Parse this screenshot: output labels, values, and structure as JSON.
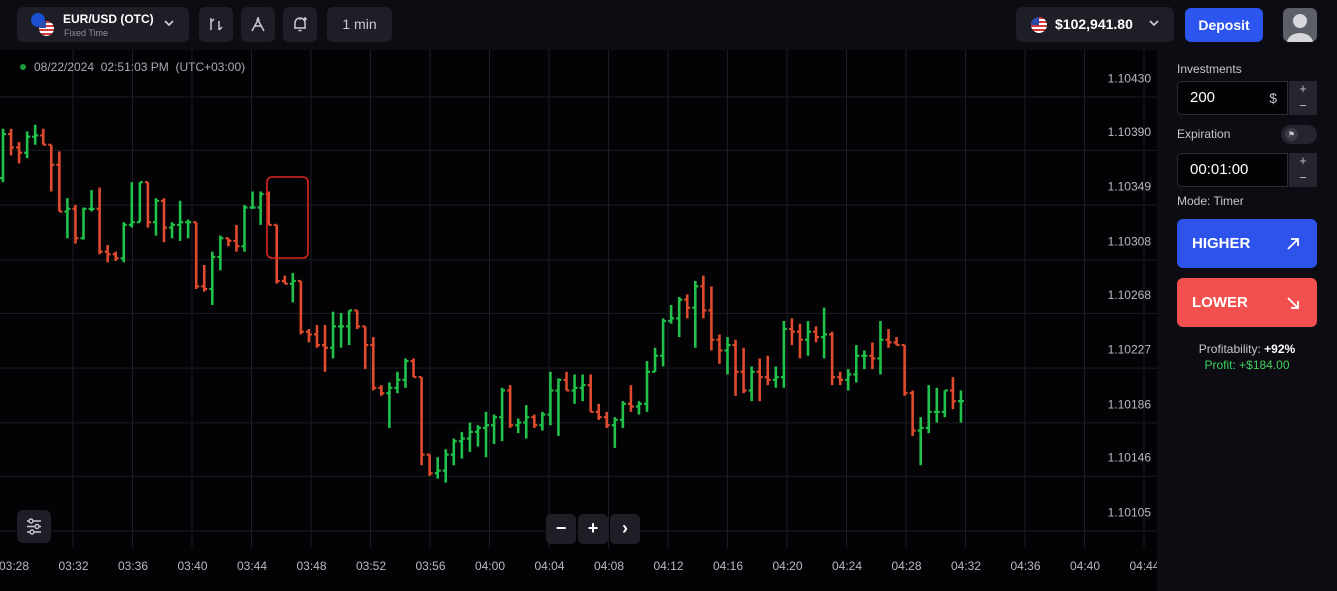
{
  "topbar": {
    "asset_name": "EUR/USD (OTC)",
    "asset_mode": "Fixed Time",
    "timeframe": "1 min",
    "balance": "$102,941.80",
    "deposit_label": "Deposit",
    "tools": [
      "drawing-tool-icon",
      "compass-indicator-icon",
      "alarm-add-icon"
    ]
  },
  "chart": {
    "timestamp": "08/22/2024",
    "time": "02:51:03 PM",
    "timezone": "(UTC+03:00)",
    "zoom_out": "−",
    "zoom_in": "+",
    "scroll_right": "›"
  },
  "chart_data": {
    "type": "ohlc",
    "y_ticks": [
      "1.10430",
      "1.10390",
      "1.10349",
      "1.10308",
      "1.10268",
      "1.10227",
      "1.10186",
      "1.10146",
      "1.10105"
    ],
    "x_ticks": [
      "03:28",
      "03:32",
      "03:36",
      "03:40",
      "03:44",
      "03:48",
      "03:52",
      "03:56",
      "04:00",
      "04:04",
      "04:08",
      "04:12",
      "04:16",
      "04:20",
      "04:24",
      "04:28",
      "04:32",
      "04:36",
      "04:40",
      "04:44"
    ],
    "up_color": "#20c24b",
    "down_color": "#e04a2d",
    "bars": [
      {
        "open": 1.10355,
        "high": 1.10392,
        "low": 1.10352,
        "close": 1.10388
      },
      {
        "open": 1.10388,
        "high": 1.10392,
        "low": 1.10372,
        "close": 1.10378
      },
      {
        "open": 1.10378,
        "high": 1.10382,
        "low": 1.10366,
        "close": 1.10374
      },
      {
        "open": 1.10374,
        "high": 1.1039,
        "low": 1.1037,
        "close": 1.10386
      },
      {
        "open": 1.10386,
        "high": 1.10395,
        "low": 1.1038,
        "close": 1.10387
      },
      {
        "open": 1.10387,
        "high": 1.10392,
        "low": 1.1038,
        "close": 1.1038
      },
      {
        "open": 1.1038,
        "high": 1.1038,
        "low": 1.10345,
        "close": 1.10365
      },
      {
        "open": 1.10365,
        "high": 1.10375,
        "low": 1.1033,
        "close": 1.1033
      },
      {
        "open": 1.1033,
        "high": 1.1034,
        "low": 1.1031,
        "close": 1.10332
      },
      {
        "open": 1.10332,
        "high": 1.10335,
        "low": 1.10306,
        "close": 1.1031
      },
      {
        "open": 1.1031,
        "high": 1.10333,
        "low": 1.10309,
        "close": 1.10332
      },
      {
        "open": 1.10332,
        "high": 1.10346,
        "low": 1.1033,
        "close": 1.10332
      },
      {
        "open": 1.10332,
        "high": 1.10348,
        "low": 1.10298,
        "close": 1.103
      },
      {
        "open": 1.103,
        "high": 1.10305,
        "low": 1.10292,
        "close": 1.10298
      },
      {
        "open": 1.10298,
        "high": 1.103,
        "low": 1.10293,
        "close": 1.10295
      },
      {
        "open": 1.10295,
        "high": 1.10322,
        "low": 1.10292,
        "close": 1.1032
      },
      {
        "open": 1.1032,
        "high": 1.10352,
        "low": 1.10318,
        "close": 1.10322
      },
      {
        "open": 1.10322,
        "high": 1.10352,
        "low": 1.10322,
        "close": 1.10352
      },
      {
        "open": 1.10352,
        "high": 1.10352,
        "low": 1.10318,
        "close": 1.10322
      },
      {
        "open": 1.10322,
        "high": 1.1034,
        "low": 1.10312,
        "close": 1.10338
      },
      {
        "open": 1.10338,
        "high": 1.1034,
        "low": 1.10307,
        "close": 1.10318
      },
      {
        "open": 1.10318,
        "high": 1.10322,
        "low": 1.1031,
        "close": 1.1032
      },
      {
        "open": 1.1032,
        "high": 1.10338,
        "low": 1.10308,
        "close": 1.10322
      },
      {
        "open": 1.10322,
        "high": 1.10324,
        "low": 1.1031,
        "close": 1.10322
      },
      {
        "open": 1.10322,
        "high": 1.10322,
        "low": 1.10272,
        "close": 1.10274
      },
      {
        "open": 1.10274,
        "high": 1.1029,
        "low": 1.1027,
        "close": 1.10272
      },
      {
        "open": 1.10272,
        "high": 1.103,
        "low": 1.1026,
        "close": 1.10296
      },
      {
        "open": 1.10296,
        "high": 1.10312,
        "low": 1.10286,
        "close": 1.1031
      },
      {
        "open": 1.1031,
        "high": 1.1031,
        "low": 1.10304,
        "close": 1.10308
      },
      {
        "open": 1.10308,
        "high": 1.1032,
        "low": 1.103,
        "close": 1.10304
      },
      {
        "open": 1.10304,
        "high": 1.10335,
        "low": 1.103,
        "close": 1.10333
      },
      {
        "open": 1.10333,
        "high": 1.10345,
        "low": 1.10332,
        "close": 1.10333
      },
      {
        "open": 1.10333,
        "high": 1.10345,
        "low": 1.1032,
        "close": 1.10343
      },
      {
        "open": 1.10343,
        "high": 1.10345,
        "low": 1.1032,
        "close": 1.1032
      },
      {
        "open": 1.1032,
        "high": 1.1032,
        "low": 1.10276,
        "close": 1.10278
      },
      {
        "open": 1.10278,
        "high": 1.10282,
        "low": 1.10276,
        "close": 1.10276
      },
      {
        "open": 1.10276,
        "high": 1.10284,
        "low": 1.10262,
        "close": 1.10278
      },
      {
        "open": 1.10278,
        "high": 1.10278,
        "low": 1.10238,
        "close": 1.1024
      },
      {
        "open": 1.1024,
        "high": 1.10242,
        "low": 1.10232,
        "close": 1.10238
      },
      {
        "open": 1.10238,
        "high": 1.10245,
        "low": 1.10228,
        "close": 1.1023
      },
      {
        "open": 1.1023,
        "high": 1.10245,
        "low": 1.1021,
        "close": 1.10228
      },
      {
        "open": 1.10228,
        "high": 1.10255,
        "low": 1.1022,
        "close": 1.10244
      },
      {
        "open": 1.10244,
        "high": 1.10254,
        "low": 1.10228,
        "close": 1.10244
      },
      {
        "open": 1.10244,
        "high": 1.10256,
        "low": 1.1023,
        "close": 1.10256
      },
      {
        "open": 1.10256,
        "high": 1.10256,
        "low": 1.10242,
        "close": 1.10244
      },
      {
        "open": 1.10244,
        "high": 1.10244,
        "low": 1.10212,
        "close": 1.1023
      },
      {
        "open": 1.1023,
        "high": 1.10236,
        "low": 1.10196,
        "close": 1.10198
      },
      {
        "open": 1.10198,
        "high": 1.102,
        "low": 1.10192,
        "close": 1.10194
      },
      {
        "open": 1.10194,
        "high": 1.10202,
        "low": 1.10168,
        "close": 1.10198
      },
      {
        "open": 1.10198,
        "high": 1.1021,
        "low": 1.10194,
        "close": 1.10204
      },
      {
        "open": 1.10204,
        "high": 1.1022,
        "low": 1.10198,
        "close": 1.10218
      },
      {
        "open": 1.10218,
        "high": 1.1022,
        "low": 1.10206,
        "close": 1.10206
      },
      {
        "open": 1.10206,
        "high": 1.10206,
        "low": 1.1014,
        "close": 1.10148
      },
      {
        "open": 1.10148,
        "high": 1.10148,
        "low": 1.10132,
        "close": 1.10134
      },
      {
        "open": 1.10134,
        "high": 1.10146,
        "low": 1.1013,
        "close": 1.10136
      },
      {
        "open": 1.10136,
        "high": 1.10152,
        "low": 1.10127,
        "close": 1.10148
      },
      {
        "open": 1.10148,
        "high": 1.1016,
        "low": 1.1014,
        "close": 1.10158
      },
      {
        "open": 1.10158,
        "high": 1.10165,
        "low": 1.10145,
        "close": 1.1016
      },
      {
        "open": 1.1016,
        "high": 1.10172,
        "low": 1.1015,
        "close": 1.10165
      },
      {
        "open": 1.10165,
        "high": 1.1017,
        "low": 1.10154,
        "close": 1.10168
      },
      {
        "open": 1.10168,
        "high": 1.1018,
        "low": 1.10146,
        "close": 1.1017
      },
      {
        "open": 1.1017,
        "high": 1.10178,
        "low": 1.10156,
        "close": 1.10176
      },
      {
        "open": 1.10176,
        "high": 1.10198,
        "low": 1.10158,
        "close": 1.10196
      },
      {
        "open": 1.10196,
        "high": 1.102,
        "low": 1.10168,
        "close": 1.1017
      },
      {
        "open": 1.1017,
        "high": 1.10175,
        "low": 1.10164,
        "close": 1.10172
      },
      {
        "open": 1.10172,
        "high": 1.10185,
        "low": 1.1016,
        "close": 1.10176
      },
      {
        "open": 1.10176,
        "high": 1.10178,
        "low": 1.10168,
        "close": 1.1017
      },
      {
        "open": 1.1017,
        "high": 1.1018,
        "low": 1.10166,
        "close": 1.10178
      },
      {
        "open": 1.10178,
        "high": 1.1021,
        "low": 1.1017,
        "close": 1.10196
      },
      {
        "open": 1.10196,
        "high": 1.10205,
        "low": 1.10162,
        "close": 1.10204
      },
      {
        "open": 1.10204,
        "high": 1.1021,
        "low": 1.10196,
        "close": 1.10196
      },
      {
        "open": 1.10196,
        "high": 1.10208,
        "low": 1.10186,
        "close": 1.10198
      },
      {
        "open": 1.10198,
        "high": 1.10208,
        "low": 1.10188,
        "close": 1.102
      },
      {
        "open": 1.102,
        "high": 1.10208,
        "low": 1.1018,
        "close": 1.1018
      },
      {
        "open": 1.1018,
        "high": 1.10186,
        "low": 1.10174,
        "close": 1.10176
      },
      {
        "open": 1.10176,
        "high": 1.1018,
        "low": 1.10168,
        "close": 1.1017
      },
      {
        "open": 1.1017,
        "high": 1.10176,
        "low": 1.10153,
        "close": 1.10174
      },
      {
        "open": 1.10174,
        "high": 1.10188,
        "low": 1.10168,
        "close": 1.10186
      },
      {
        "open": 1.10186,
        "high": 1.102,
        "low": 1.1018,
        "close": 1.10184
      },
      {
        "open": 1.10184,
        "high": 1.10188,
        "low": 1.10178,
        "close": 1.10186
      },
      {
        "open": 1.10186,
        "high": 1.10218,
        "low": 1.1018,
        "close": 1.1021
      },
      {
        "open": 1.1021,
        "high": 1.10228,
        "low": 1.1021,
        "close": 1.10222
      },
      {
        "open": 1.10222,
        "high": 1.1025,
        "low": 1.10214,
        "close": 1.10248
      },
      {
        "open": 1.10248,
        "high": 1.1026,
        "low": 1.10246,
        "close": 1.1025
      },
      {
        "open": 1.1025,
        "high": 1.10266,
        "low": 1.10236,
        "close": 1.10264
      },
      {
        "open": 1.10264,
        "high": 1.10268,
        "low": 1.1025,
        "close": 1.10258
      },
      {
        "open": 1.10258,
        "high": 1.10278,
        "low": 1.10228,
        "close": 1.10274
      },
      {
        "open": 1.10274,
        "high": 1.10282,
        "low": 1.1025,
        "close": 1.10256
      },
      {
        "open": 1.10256,
        "high": 1.10274,
        "low": 1.10226,
        "close": 1.10234
      },
      {
        "open": 1.10234,
        "high": 1.10238,
        "low": 1.10216,
        "close": 1.10226
      },
      {
        "open": 1.10226,
        "high": 1.10236,
        "low": 1.10208,
        "close": 1.1023
      },
      {
        "open": 1.1023,
        "high": 1.10234,
        "low": 1.10192,
        "close": 1.1021
      },
      {
        "open": 1.1021,
        "high": 1.10228,
        "low": 1.10194,
        "close": 1.10196
      },
      {
        "open": 1.10196,
        "high": 1.10214,
        "low": 1.10188,
        "close": 1.1021
      },
      {
        "open": 1.1021,
        "high": 1.1022,
        "low": 1.10188,
        "close": 1.10206
      },
      {
        "open": 1.10206,
        "high": 1.10222,
        "low": 1.102,
        "close": 1.10204
      },
      {
        "open": 1.10204,
        "high": 1.10214,
        "low": 1.10198,
        "close": 1.10206
      },
      {
        "open": 1.10206,
        "high": 1.10248,
        "low": 1.10198,
        "close": 1.10242
      },
      {
        "open": 1.10242,
        "high": 1.1025,
        "low": 1.1023,
        "close": 1.1024
      },
      {
        "open": 1.1024,
        "high": 1.10246,
        "low": 1.1022,
        "close": 1.10234
      },
      {
        "open": 1.10234,
        "high": 1.10248,
        "low": 1.10222,
        "close": 1.1024
      },
      {
        "open": 1.1024,
        "high": 1.10244,
        "low": 1.10232,
        "close": 1.10236
      },
      {
        "open": 1.10236,
        "high": 1.10258,
        "low": 1.1022,
        "close": 1.10238
      },
      {
        "open": 1.10238,
        "high": 1.1024,
        "low": 1.102,
        "close": 1.10206
      },
      {
        "open": 1.10206,
        "high": 1.1021,
        "low": 1.102,
        "close": 1.10204
      },
      {
        "open": 1.10204,
        "high": 1.10212,
        "low": 1.10196,
        "close": 1.10208
      },
      {
        "open": 1.10208,
        "high": 1.1023,
        "low": 1.10202,
        "close": 1.10222
      },
      {
        "open": 1.10222,
        "high": 1.10226,
        "low": 1.10212,
        "close": 1.10222
      },
      {
        "open": 1.10222,
        "high": 1.10232,
        "low": 1.10212,
        "close": 1.1022
      },
      {
        "open": 1.1022,
        "high": 1.10248,
        "low": 1.10208,
        "close": 1.10234
      },
      {
        "open": 1.10234,
        "high": 1.10242,
        "low": 1.10228,
        "close": 1.10232
      },
      {
        "open": 1.10232,
        "high": 1.10236,
        "low": 1.1023,
        "close": 1.1023
      },
      {
        "open": 1.1023,
        "high": 1.1023,
        "low": 1.10192,
        "close": 1.10194
      },
      {
        "open": 1.10194,
        "high": 1.10196,
        "low": 1.10162,
        "close": 1.10166
      },
      {
        "open": 1.10166,
        "high": 1.10176,
        "low": 1.1014,
        "close": 1.10168
      },
      {
        "open": 1.10168,
        "high": 1.102,
        "low": 1.10164,
        "close": 1.1018
      },
      {
        "open": 1.1018,
        "high": 1.10198,
        "low": 1.10172,
        "close": 1.1018
      },
      {
        "open": 1.1018,
        "high": 1.10196,
        "low": 1.10176,
        "close": 1.10196
      },
      {
        "open": 1.10196,
        "high": 1.10206,
        "low": 1.10182,
        "close": 1.10188
      },
      {
        "open": 1.10188,
        "high": 1.10196,
        "low": 1.10172,
        "close": 1.10188
      }
    ]
  },
  "panel": {
    "investments_label": "Investments",
    "investment_value": "200",
    "currency": "$",
    "plus": "+",
    "minus": "−",
    "expiration_label": "Expiration",
    "expiration_value": "00:01:00",
    "mode": "Mode: Timer",
    "higher_label": "HIGHER",
    "lower_label": "LOWER",
    "profitability_label": "Profitability:",
    "profitability_value": "+92%",
    "profit_label": "Profit:",
    "profit_value": "+$184.00",
    "higher_color": "#2d53eb",
    "lower_color": "#f2504f"
  }
}
